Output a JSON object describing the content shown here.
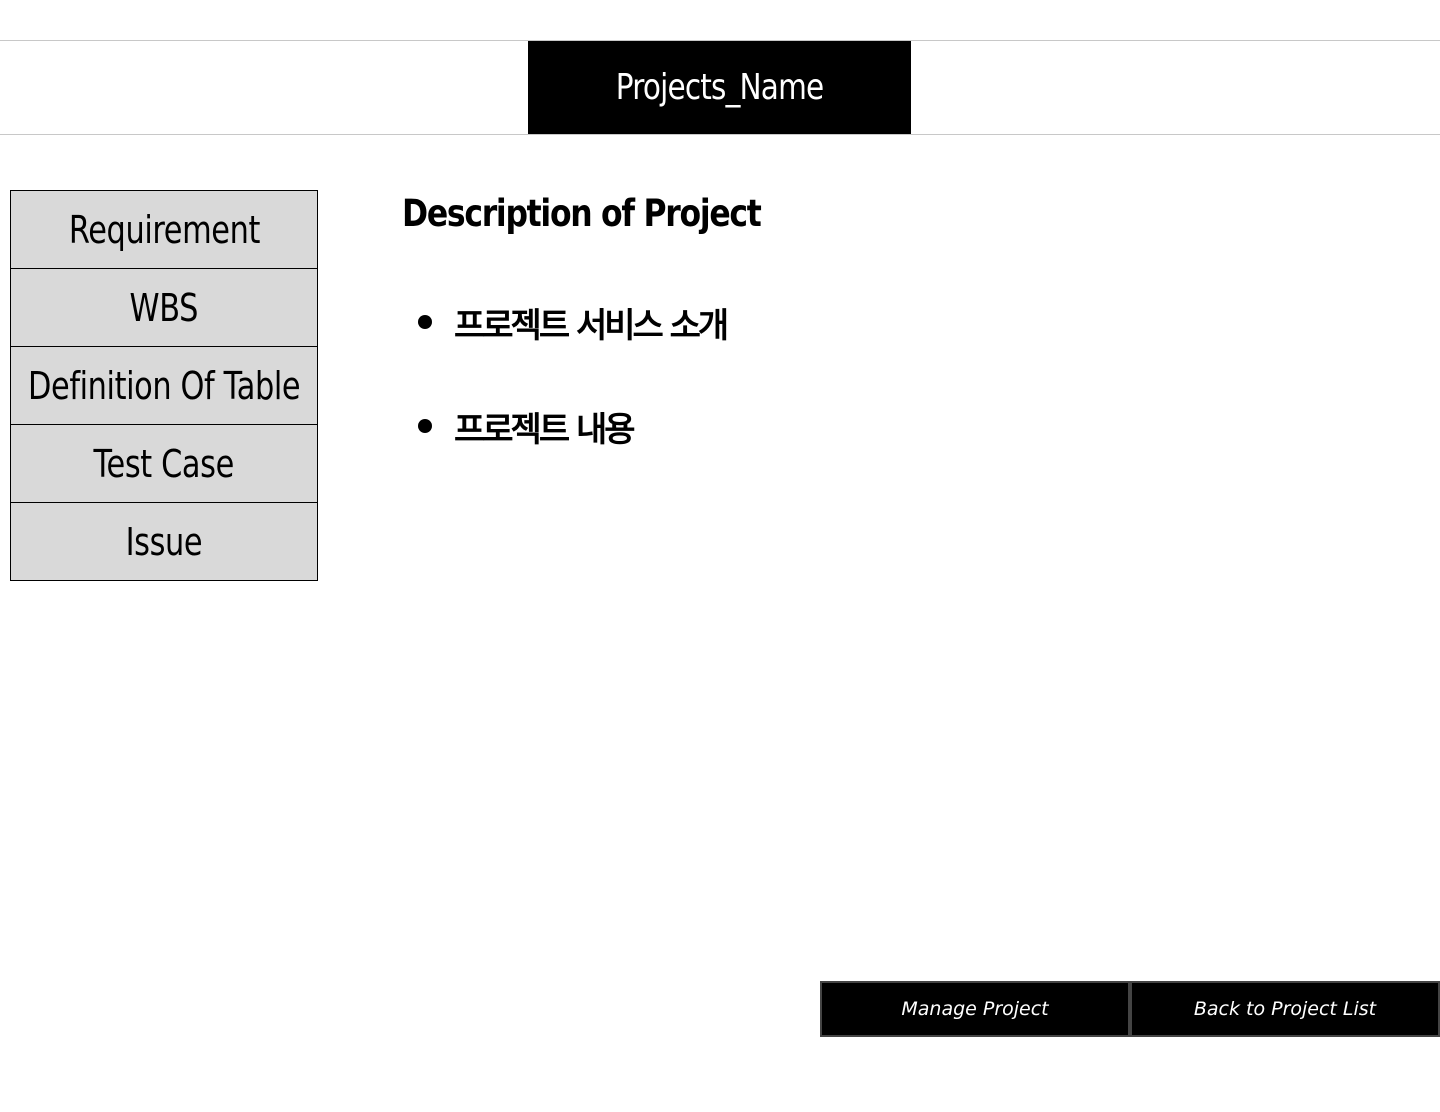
{
  "header": {
    "title": "Projects_Name"
  },
  "sidebar": {
    "items": [
      {
        "label": "Requirement"
      },
      {
        "label": "WBS"
      },
      {
        "label": "Definition Of Table"
      },
      {
        "label": "Test Case"
      },
      {
        "label": "Issue"
      }
    ]
  },
  "main": {
    "title": "Description of Project",
    "bullets": [
      {
        "text": "프로젝트 서비스 소개"
      },
      {
        "text": "프로젝트 내용"
      }
    ]
  },
  "footer": {
    "manage_label": "Manage Project",
    "back_label": "Back to Project List"
  },
  "colors": {
    "header_bg": "#000000",
    "sidebar_bg": "#d9d9d9",
    "button_bg": "#000000"
  }
}
